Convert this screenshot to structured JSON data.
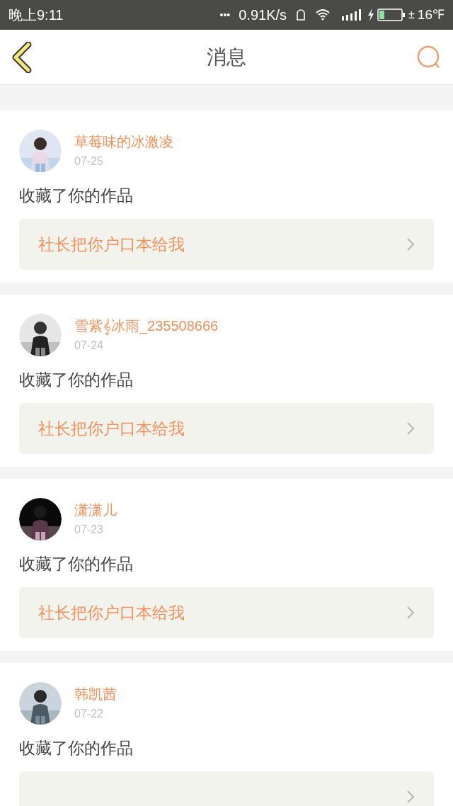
{
  "status_bar": {
    "time": "晚上9:11",
    "dots": "•••",
    "speed": "0.91K/s",
    "battery_sign": "±",
    "temperature": "16℉"
  },
  "header": {
    "title": "消息"
  },
  "messages": [
    {
      "name": "草莓味的冰激凌",
      "date": "07-25",
      "action": "收藏了你的作品",
      "link": "社长把你户口本给我"
    },
    {
      "name": "雪紫𝄞冰雨_235508666",
      "date": "07-24",
      "action": "收藏了你的作品",
      "link": "社长把你户口本给我"
    },
    {
      "name": "潇潇儿",
      "date": "07-23",
      "action": "收藏了你的作品",
      "link": "社长把你户口本给我"
    },
    {
      "name": "韩凯茜",
      "date": "07-22",
      "action": "收藏了你的作品"
    }
  ]
}
